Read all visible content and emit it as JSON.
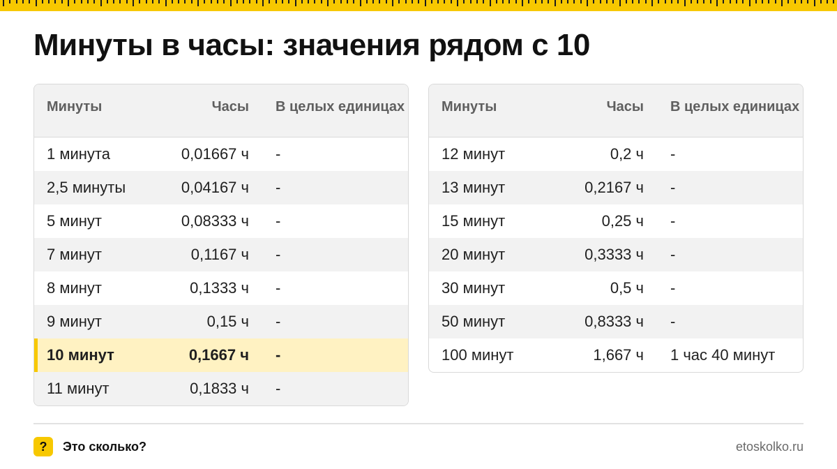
{
  "title": "Минуты в часы: значения рядом с 10",
  "accent_color": "#f7c800",
  "highlight_color": "#fff2c2",
  "columns": {
    "minutes": "Минуты",
    "hours": "Часы",
    "whole_units": "В целых единицах"
  },
  "left_table": [
    {
      "minutes": "1 минута",
      "hours": "0,01667 ч",
      "whole": "-"
    },
    {
      "minutes": "2,5 минуты",
      "hours": "0,04167 ч",
      "whole": "-"
    },
    {
      "minutes": "5 минут",
      "hours": "0,08333 ч",
      "whole": "-"
    },
    {
      "minutes": "7 минут",
      "hours": "0,1167 ч",
      "whole": "-"
    },
    {
      "minutes": "8 минут",
      "hours": "0,1333 ч",
      "whole": "-"
    },
    {
      "minutes": "9 минут",
      "hours": "0,15 ч",
      "whole": "-"
    },
    {
      "minutes": "10 минут",
      "hours": "0,1667 ч",
      "whole": "-",
      "highlighted": true
    },
    {
      "minutes": "11 минут",
      "hours": "0,1833 ч",
      "whole": "-"
    }
  ],
  "right_table": [
    {
      "minutes": "12 минут",
      "hours": "0,2 ч",
      "whole": "-"
    },
    {
      "minutes": "13 минут",
      "hours": "0,2167 ч",
      "whole": "-"
    },
    {
      "minutes": "15 минут",
      "hours": "0,25 ч",
      "whole": "-"
    },
    {
      "minutes": "20 минут",
      "hours": "0,3333 ч",
      "whole": "-"
    },
    {
      "minutes": "30 минут",
      "hours": "0,5 ч",
      "whole": "-"
    },
    {
      "minutes": "50 минут",
      "hours": "0,8333 ч",
      "whole": "-"
    },
    {
      "minutes": "100 минут",
      "hours": "1,667 ч",
      "whole": "1 час 40 минут"
    }
  ],
  "footer": {
    "logo_glyph": "?",
    "brand": "Это сколько?",
    "site": "etoskolko.ru"
  }
}
